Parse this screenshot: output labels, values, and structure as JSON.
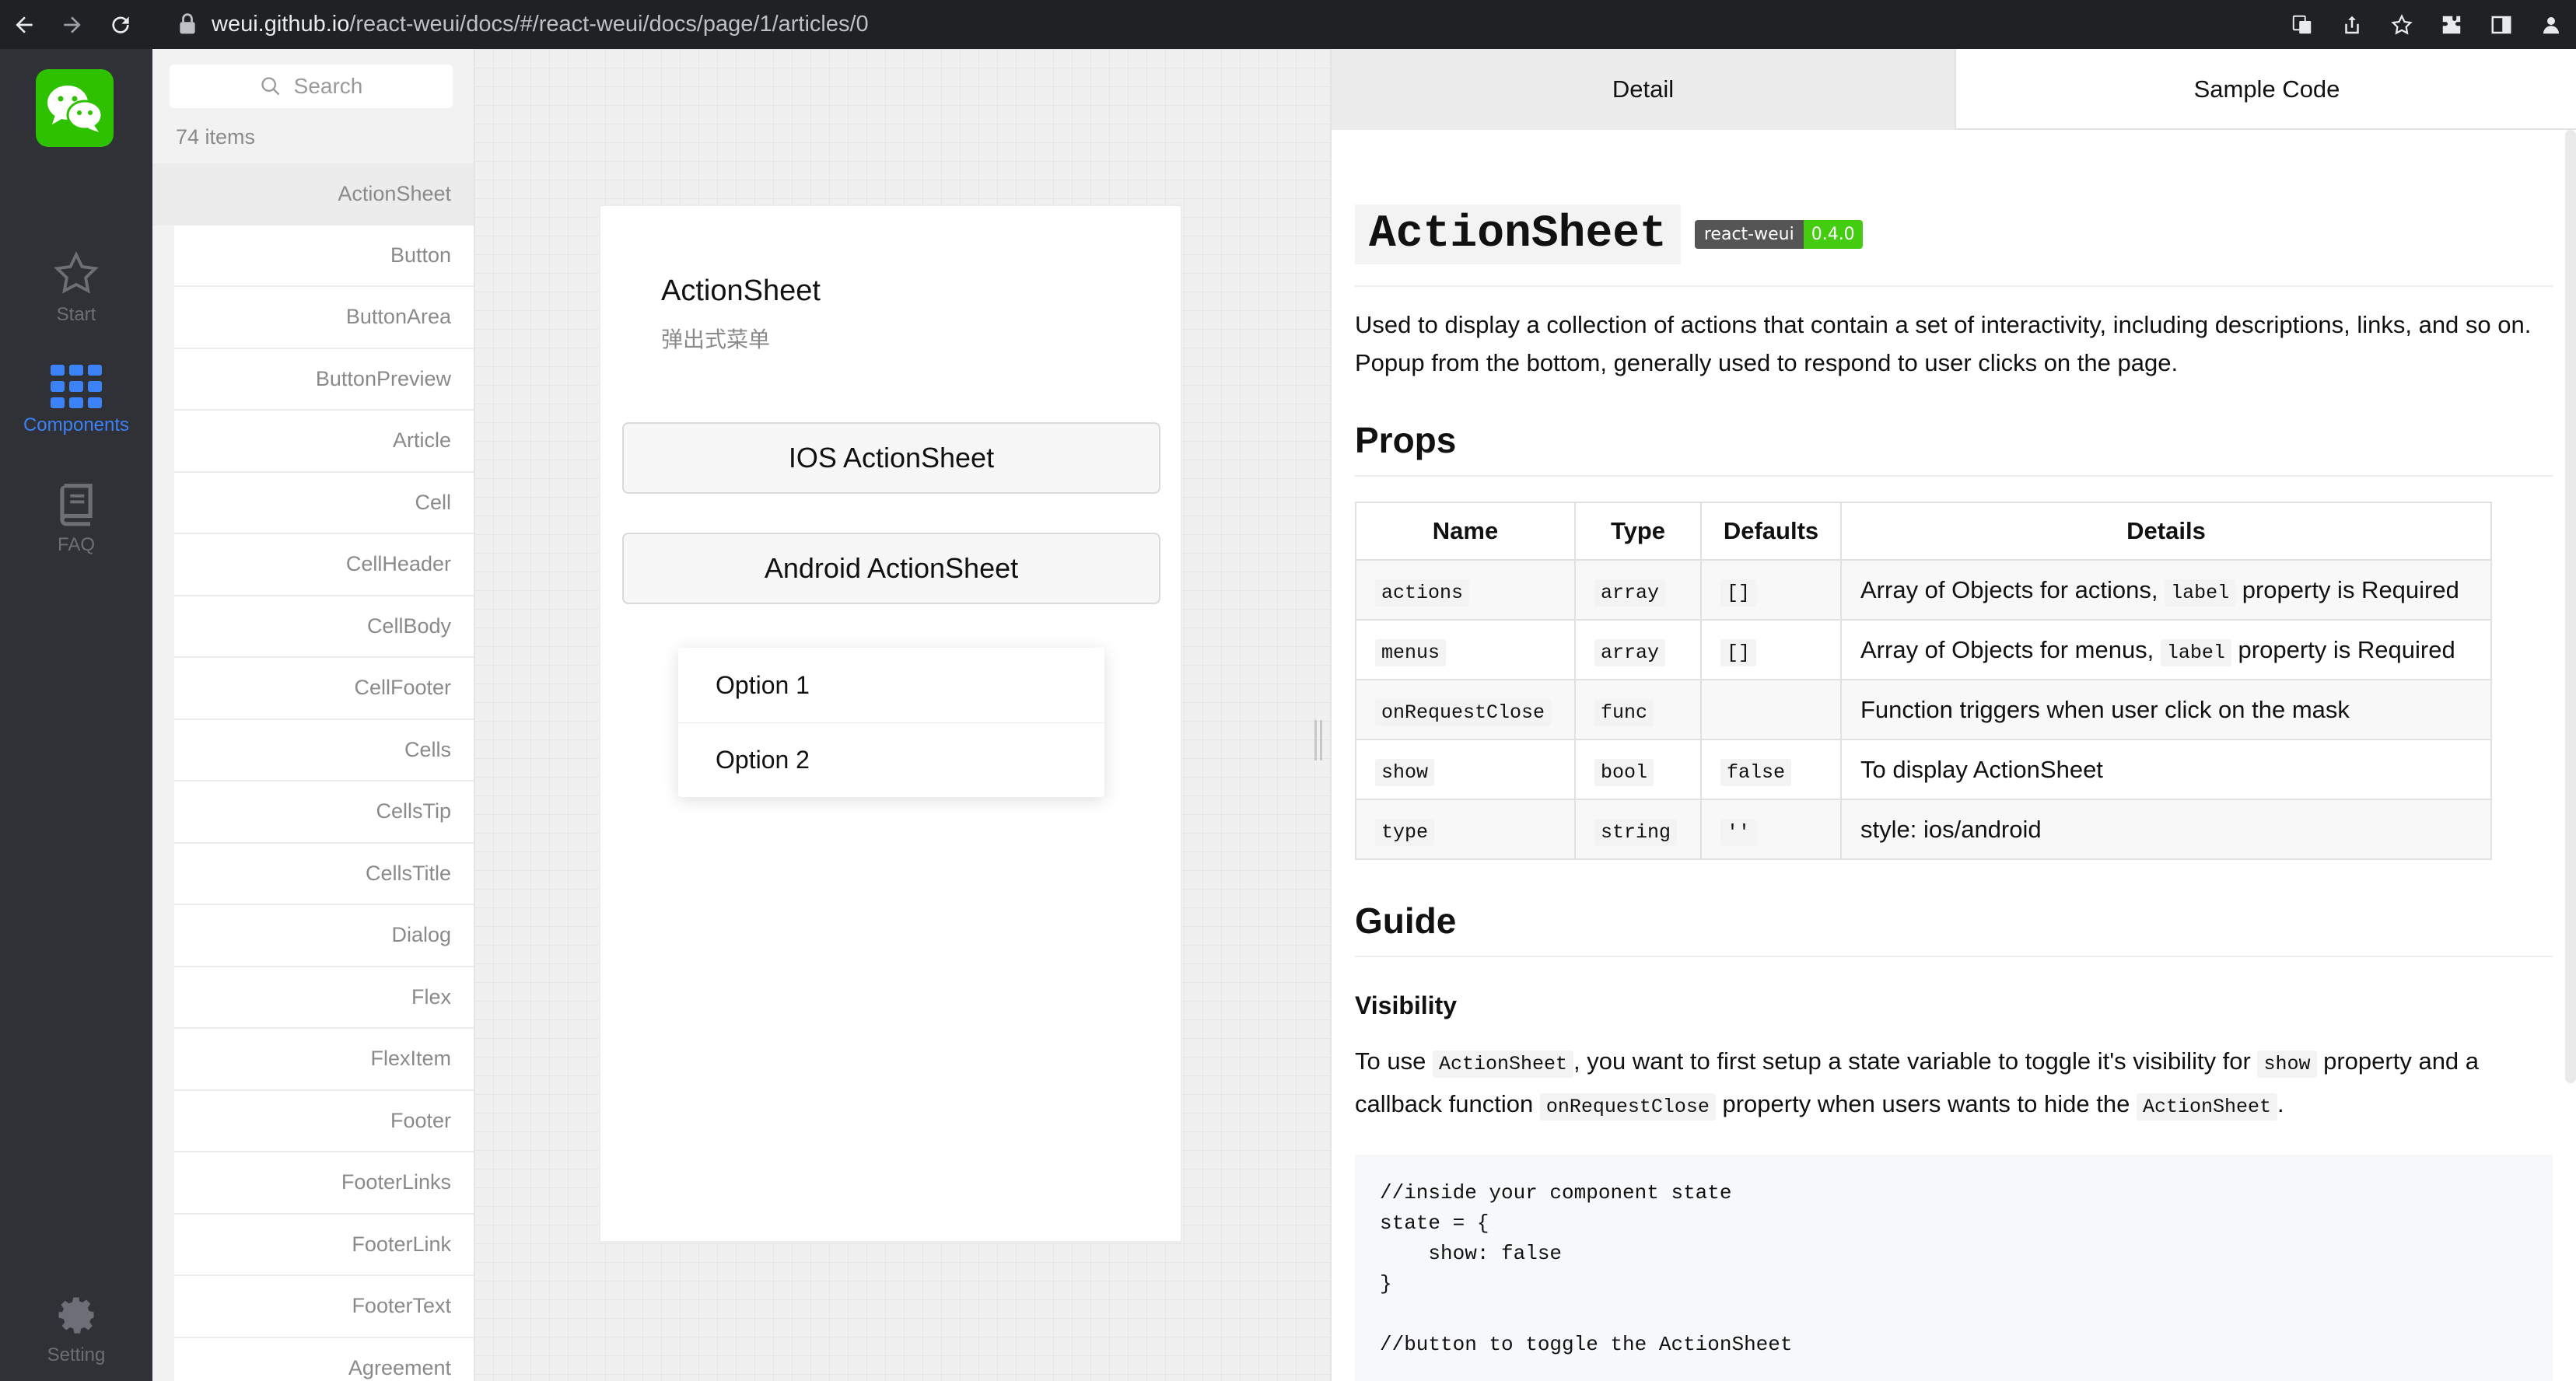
{
  "browser": {
    "url_host": "weui.github.io",
    "url_path": "/react-weui/docs/#/react-weui/docs/page/1/articles/0",
    "icons": [
      "back-icon",
      "forward-icon",
      "reload-icon",
      "lock-icon",
      "translate-icon",
      "share-icon",
      "star-icon",
      "extensions-icon",
      "sidepanel-icon",
      "profile-icon"
    ]
  },
  "rail": {
    "items": [
      {
        "label": "Start",
        "icon": "star-icon"
      },
      {
        "label": "Components",
        "icon": "grid-icon"
      },
      {
        "label": "FAQ",
        "icon": "book-icon"
      },
      {
        "label": "Setting",
        "icon": "gear-icon"
      }
    ],
    "active_color": "#3b82f6"
  },
  "list": {
    "search_placeholder": "Search",
    "count": "74 items",
    "items": [
      "ActionSheet",
      "Button",
      "ButtonArea",
      "ButtonPreview",
      "Article",
      "Cell",
      "CellHeader",
      "CellBody",
      "CellFooter",
      "Cells",
      "CellsTip",
      "CellsTitle",
      "Dialog",
      "Flex",
      "FlexItem",
      "Footer",
      "FooterLinks",
      "FooterLink",
      "FooterText",
      "Agreement"
    ]
  },
  "preview": {
    "title": "ActionSheet",
    "subtitle": "弹出式菜单",
    "buttons": [
      "IOS ActionSheet",
      "Android ActionSheet"
    ],
    "options": [
      "Option 1",
      "Option 2"
    ]
  },
  "docs": {
    "tabs": [
      "Detail",
      "Sample Code"
    ],
    "title": "ActionSheet",
    "badge_left": "react-weui",
    "badge_right": "0.4.0",
    "description": "Used to display a collection of actions that contain a set of interactivity, including descriptions, links, and so on. Popup from the bottom, generally used to respond to user clicks on the page.",
    "props_heading": "Props",
    "table_headers": [
      "Name",
      "Type",
      "Defaults",
      "Details"
    ],
    "rows": [
      {
        "name": "actions",
        "type": "array",
        "default": "[]",
        "details_pre": "Array of Objects for actions, ",
        "details_code": "label",
        "details_post": " property is Required"
      },
      {
        "name": "menus",
        "type": "array",
        "default": "[]",
        "details_pre": "Array of Objects for menus, ",
        "details_code": "label",
        "details_post": " property is Required"
      },
      {
        "name": "onRequestClose",
        "type": "func",
        "default": "",
        "details_pre": "Function triggers when user click on the mask",
        "details_code": "",
        "details_post": ""
      },
      {
        "name": "show",
        "type": "bool",
        "default": "false",
        "details_pre": "To display ActionSheet",
        "details_code": "",
        "details_post": ""
      },
      {
        "name": "type",
        "type": "string",
        "default": "''",
        "details_pre": "style: ios/android",
        "details_code": "",
        "details_post": ""
      }
    ],
    "guide_heading": "Guide",
    "visibility_heading": "Visibility",
    "guide": {
      "t1": "To use ",
      "c1": "ActionSheet",
      "t2": ", you want to first setup a state variable to toggle it's visibility for ",
      "c2": "show",
      "t3": " property and a callback function ",
      "c3": "onRequestClose",
      "t4": " property when users wants to hide the ",
      "c4": "ActionSheet",
      "t5": "."
    },
    "code": "//inside your component state\nstate = {\n    show: false\n}\n\n//button to toggle the ActionSheet"
  }
}
